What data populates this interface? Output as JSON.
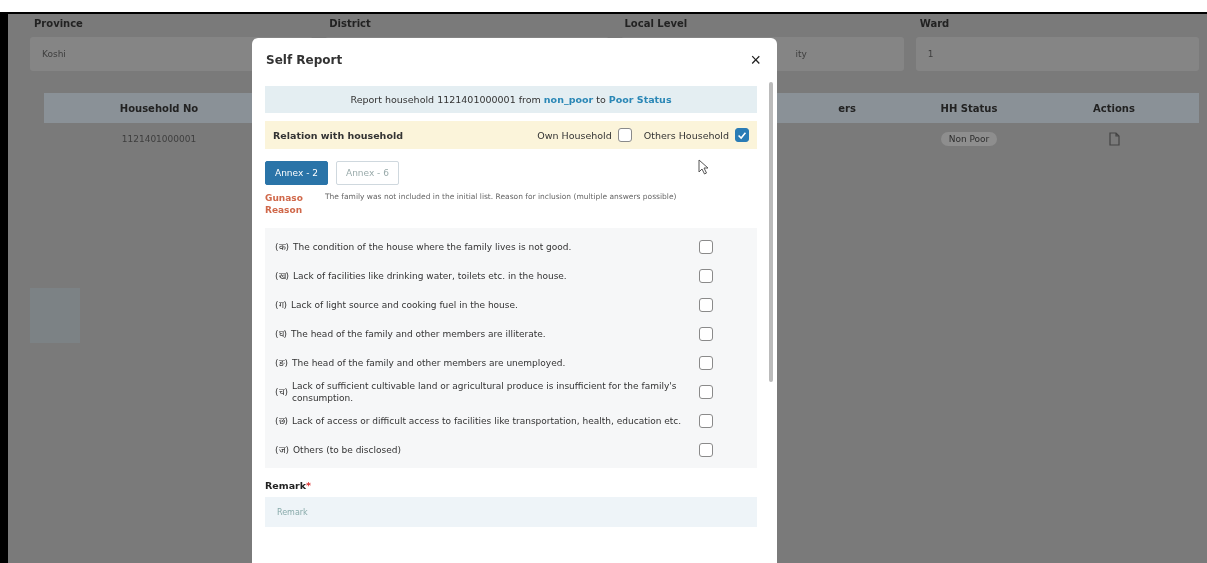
{
  "filters": [
    {
      "label": "Province",
      "value": "Koshi"
    },
    {
      "label": "District"
    },
    {
      "label": "Local Level",
      "value": "ity"
    },
    {
      "label": "Ward",
      "value": "1"
    }
  ],
  "table": {
    "columns": [
      "Household No",
      "ers",
      "HH Status",
      "Actions"
    ],
    "rows": [
      {
        "household_no": "1121401000001",
        "hh_status": "Non Poor"
      }
    ]
  },
  "modal": {
    "title": "Self Report",
    "close": "×",
    "banner": {
      "prefix": "Report household 1121401000001 from ",
      "from": "non_poor",
      "middle": " to ",
      "to": "Poor Status"
    },
    "relation": {
      "label": "Relation with household",
      "options": [
        {
          "label": "Own Household",
          "checked": false
        },
        {
          "label": "Others Household",
          "checked": true
        }
      ]
    },
    "tabs": [
      {
        "label": "Annex - 2",
        "selected": true
      },
      {
        "label": "Annex - 6",
        "selected": false
      }
    ],
    "reason_label": "Gunaso Reason",
    "reason_text": "The family was not included in the initial list. Reason for inclusion (multiple answers possible)",
    "items": [
      {
        "mark": "(क)",
        "text": "The condition of the house where the family lives is not good.",
        "checked": false
      },
      {
        "mark": "(ख)",
        "text": "Lack of facilities like drinking water, toilets etc. in the house.",
        "checked": false
      },
      {
        "mark": "(ग)",
        "text": "Lack of light source and cooking fuel in the house.",
        "checked": false
      },
      {
        "mark": "(घ)",
        "text": "The head of the family and other members are illiterate.",
        "checked": false
      },
      {
        "mark": "(ङ)",
        "text": "The head of the family and other members are unemployed.",
        "checked": false
      },
      {
        "mark": "(च)",
        "text": "Lack of sufficient cultivable land or agricultural produce is insufficient for the family's consumption.",
        "checked": false
      },
      {
        "mark": "(छ)",
        "text": "Lack of access or difficult access to facilities like transportation, health, education etc.",
        "checked": false
      },
      {
        "mark": "(ज)",
        "text": "Others (to be disclosed)",
        "checked": false
      }
    ],
    "remark": {
      "label": "Remark",
      "required_mark": "*",
      "placeholder": "Remark"
    }
  }
}
